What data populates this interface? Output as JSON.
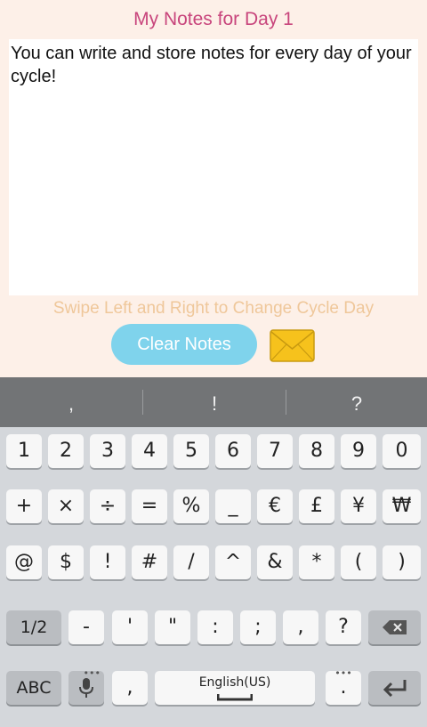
{
  "header": {
    "title": "My Notes for Day 1"
  },
  "notes": {
    "text": "You can write and store notes for every day of your cycle!"
  },
  "hint": "Swipe Left and Right to Change Cycle Day",
  "buttons": {
    "clear": "Clear Notes",
    "mail_icon": "envelope-icon"
  },
  "colors": {
    "title": "#c8457c",
    "hint": "#efc79a",
    "button": "#7fd3ec",
    "background": "#fdf0e8",
    "envelope": "#f6c21c"
  },
  "keyboard": {
    "suggestions": [
      ",",
      "!",
      "?"
    ],
    "row1": [
      "1",
      "2",
      "3",
      "4",
      "5",
      "6",
      "7",
      "8",
      "9",
      "0"
    ],
    "row2": [
      "+",
      "×",
      "÷",
      "=",
      "%",
      "_",
      "€",
      "£",
      "¥",
      "₩"
    ],
    "row3": [
      "@",
      "$",
      "!",
      "#",
      "/",
      "^",
      "&",
      "*",
      "(",
      ")"
    ],
    "row4": {
      "toggle": "1/2",
      "keys": [
        "-",
        "'",
        "\"",
        ":",
        ";",
        ",",
        "?"
      ],
      "backspace_icon": "backspace-icon"
    },
    "row5": {
      "abc": "ABC",
      "mic_icon": "microphone-icon",
      "comma": ",",
      "space_label": "English(US)",
      "period": ".",
      "enter_icon": "enter-icon"
    }
  }
}
